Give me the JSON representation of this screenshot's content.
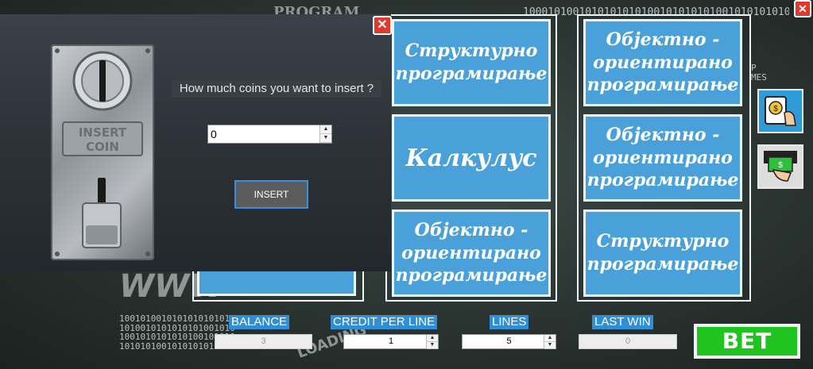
{
  "background": {
    "top_text": "PROGRAM",
    "binary_top": "1000101001010101010100101010101001010101010",
    "binary_bottom_left": "1001010010101010101010\n1010010101010101001010\n1001010101010100101010\n1010101001010101010010",
    "chalk_w": "WWW",
    "chalk_loading": "LOADING",
    "chalk_games": "P\nMES"
  },
  "dialog": {
    "question": "How much coins you want to insert ?",
    "coin_value": "0",
    "insert_label": "INSERT",
    "plate_text_line1": "INSERT",
    "plate_text_line2": "COIN",
    "close_glyph": "✕"
  },
  "window": {
    "close_glyph": "✕"
  },
  "reels": {
    "col1": [
      "Структурно програмирање",
      "Калкулус",
      "Објектно - ориентирано програмирање"
    ],
    "col2": [
      "Објектно - ориентирано програмирање",
      "Објектно - ориентирано програмирање",
      "Структурно програмирање"
    ]
  },
  "side_buttons": [
    {
      "icon": "insert-coin-icon"
    },
    {
      "icon": "cash-out-icon"
    }
  ],
  "stats": {
    "balance_label": "BALANCE",
    "balance_value": "3",
    "credit_label": "CREDIT PER LINE",
    "credit_value": "1",
    "lines_label": "LINES",
    "lines_value": "5",
    "last_win_label": "LAST WIN",
    "last_win_value": "0"
  },
  "bet_label": "BET",
  "colors": {
    "tile": "#4aa0d8",
    "accent": "#2e8fd6",
    "bet": "#1fc41f",
    "close": "#e03a2e"
  }
}
